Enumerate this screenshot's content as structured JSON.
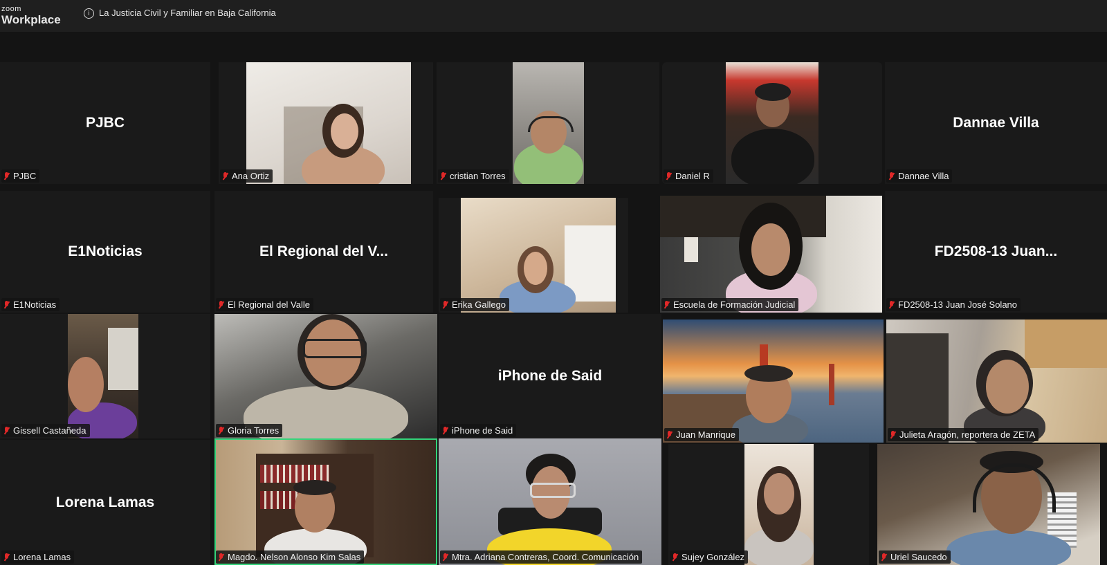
{
  "app": {
    "logo_small": "zoom",
    "logo_big": "Workplace"
  },
  "meeting": {
    "title": "La Justicia Civil y Familiar en Baja California"
  },
  "participants": [
    {
      "name": "PJBC",
      "display": "PJBC",
      "video": false,
      "muted": true
    },
    {
      "name": "Ana Ortiz",
      "video": true,
      "muted": true
    },
    {
      "name": "cristian Torres",
      "video": true,
      "muted": true
    },
    {
      "name": "Daniel R",
      "video": true,
      "muted": true
    },
    {
      "name": "Dannae Villa",
      "display": "Dannae Villa",
      "video": false,
      "muted": true
    },
    {
      "name": "E1Noticias",
      "display": "E1Noticias",
      "video": false,
      "muted": true
    },
    {
      "name": "El Regional del Valle",
      "display": "El Regional del V...",
      "video": false,
      "muted": true
    },
    {
      "name": "Erika Gallego",
      "video": true,
      "muted": true
    },
    {
      "name": "Escuela de Formación Judicial",
      "video": true,
      "muted": true
    },
    {
      "name": "FD2508-13 Juan José Solano",
      "display": "FD2508-13  Juan...",
      "video": false,
      "muted": true
    },
    {
      "name": "Gissell Castañeda",
      "video": true,
      "muted": true
    },
    {
      "name": "Gloria Torres",
      "video": true,
      "muted": true
    },
    {
      "name": "iPhone de Said",
      "display": "iPhone de Said",
      "video": false,
      "muted": true
    },
    {
      "name": "Juan Manrique",
      "video": true,
      "muted": true
    },
    {
      "name": "Julieta Aragón, reportera de ZETA",
      "video": true,
      "muted": true
    },
    {
      "name": "Lorena Lamas",
      "display": "Lorena Lamas",
      "video": false,
      "muted": true
    },
    {
      "name": "Magdo. Nelson Alonso Kim Salas",
      "video": true,
      "muted": true,
      "active_speaker": true
    },
    {
      "name": "Mtra. Adriana Contreras, Coord. Comunicación",
      "video": true,
      "muted": true
    },
    {
      "name": "Sujey González",
      "video": true,
      "muted": true
    },
    {
      "name": "Uriel Saucedo",
      "video": true,
      "muted": true
    }
  ],
  "colors": {
    "background": "#141414",
    "topbar": "#1f1f1f",
    "muted_icon": "#e02828",
    "active_speaker_border": "#33d47a"
  },
  "icons": {
    "info": "info-icon",
    "muted": "mic-muted-icon"
  }
}
